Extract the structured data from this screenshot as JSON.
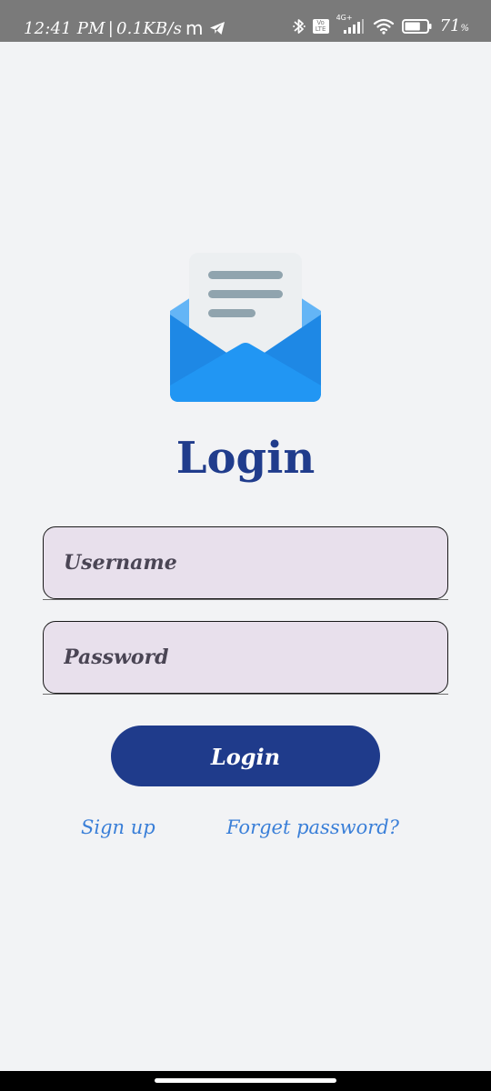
{
  "status_bar": {
    "time": "12:41 PM",
    "separator": "|",
    "data_speed": "0.1KB/s",
    "network_type": "4G+",
    "volte_label": "Vo LTE",
    "battery_percent": "71",
    "battery_unit": "%",
    "battery_level": 0.71,
    "icons": [
      "m-icon",
      "telegram-icon",
      "bluetooth-icon",
      "volte-icon",
      "signal-icon",
      "wifi-icon",
      "battery-icon"
    ]
  },
  "header": {
    "title": "Login"
  },
  "form": {
    "username_placeholder": "Username",
    "username_value": "",
    "password_placeholder": "Password",
    "password_value": "",
    "login_label": "Login"
  },
  "links": {
    "signup": "Sign up",
    "forgot": "Forget password?"
  },
  "colors": {
    "background": "#f2f3f5",
    "primary": "#1f3b8b",
    "title": "#203c8c",
    "link": "#3a7fd8",
    "field_background": "#e8e0ec",
    "status_bar": "#7a7a7a",
    "envelope": "#2196f3"
  }
}
